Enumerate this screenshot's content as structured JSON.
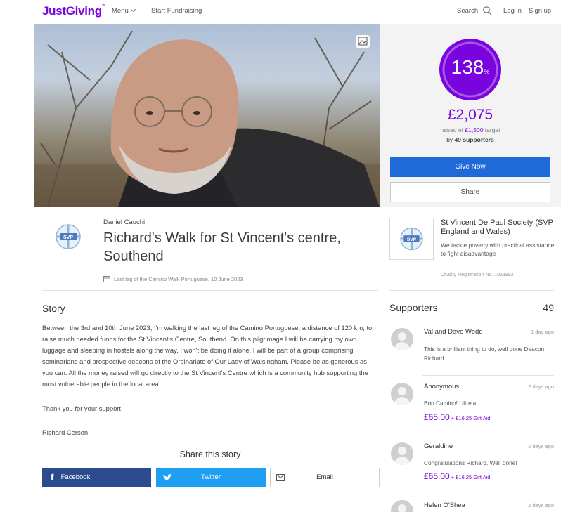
{
  "header": {
    "logo": "JustGiving",
    "logo_tm": "™",
    "menu_label": "Menu",
    "start_label": "Start Fundraising",
    "search_label": "Search",
    "login_label": "Log in",
    "signup_label": "Sign up"
  },
  "donation": {
    "percent": "138",
    "percent_sign": "%",
    "percent_value": 1.38,
    "raised": "£2,075",
    "target_prefix": "raised of ",
    "target": "£1,500",
    "target_suffix": " target",
    "supporters_prefix": "by ",
    "supporters": "49",
    "supporters_suffix": " supporters",
    "give_button": "Give Now",
    "share_button": "Share",
    "accent_color": "#7a04dd",
    "button_color": "#1f69d9"
  },
  "page": {
    "owner": "Daniel Cauchi",
    "title": "Richard's Walk for St Vincent's centre, Southend",
    "event": "Last leg of the Camino Walk Portuguese, 10 June 2023",
    "logo_text": "SVP"
  },
  "charity": {
    "name": "St Vincent De Paul Society (SVP England and Wales)",
    "description": "We tackle poverty with practical assistance to fight disadvantage",
    "registration": "Charity Registration No. 1053992",
    "logo_text": "SVP"
  },
  "story": {
    "heading": "Story",
    "body": "Between the 3rd and 10th June 2023, I'm walking the last leg of the Camino Portuguese, a distance of 120 km, to raise much needed funds for the St Vincent's Centre, Southend. On this pilgrimage I will be carrying my own luggage and sleeping in hostels along the way. I won't be doing it alone, I will be part of a group comprising seminarians and prospective deacons of the Ordinariate of Our Lady of Walsingham. Please be as generous as you can. All the money raised will go directly to the St Vincent's Centre which is a community hub supporting the most vulnerable people in the local area.",
    "thanks": "Thank you for your support",
    "signature": "Richard Cerson",
    "share_heading": "Share this story",
    "share_buttons": {
      "facebook": "Facebook",
      "twitter": "Twitter",
      "email": "Email"
    }
  },
  "supporters": {
    "heading": "Supporters",
    "total": "49",
    "items": [
      {
        "name": "Val and Dave Wedd",
        "time": "1 day ago",
        "message": "This is a brilliant thing to do, well done Deacon Richard",
        "amount": "",
        "gift_aid": ""
      },
      {
        "name": "Anonymous",
        "time": "2 days ago",
        "message": "Bon Camino! Ultreia!",
        "amount": "£65.00",
        "gift_aid": " + £16.25 Gift Aid"
      },
      {
        "name": "Geraldine",
        "time": "2 days ago",
        "message": "Congratulations Richard. Well done!",
        "amount": "£65.00",
        "gift_aid": " + £16.25 Gift Aid"
      },
      {
        "name": "Helen O'Shea",
        "time": "2 days ago",
        "message": "",
        "amount": "",
        "gift_aid": ""
      }
    ]
  }
}
